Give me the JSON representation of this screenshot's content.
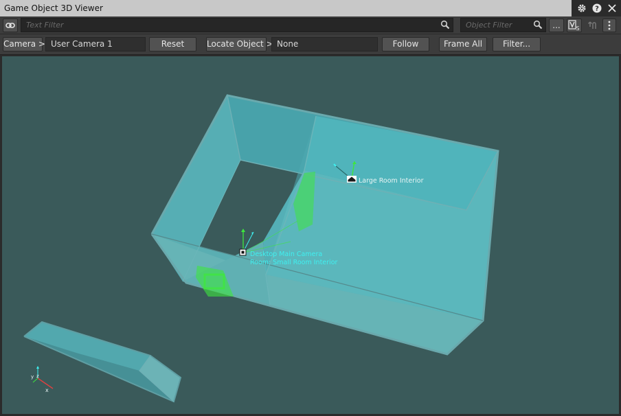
{
  "window": {
    "title": "Game Object 3D Viewer",
    "icons": [
      "gear-icon",
      "help-icon",
      "close-icon"
    ]
  },
  "toolbar": {
    "text_filter_placeholder": "Text Filter",
    "object_filter_placeholder": "Object Filter",
    "more_label": "...",
    "icons": [
      "link-icon",
      "search-icon",
      "filter-vs-icon",
      "undo-icon",
      "kebab-menu-icon"
    ]
  },
  "camera_bar": {
    "camera_label": "Camera >",
    "camera_value": "User Camera 1",
    "reset_label": "Reset",
    "locate_label": "Locate Object >",
    "locate_value": "None",
    "follow_label": "Follow",
    "frame_all_label": "Frame All",
    "filter_label": "Filter..."
  },
  "scene": {
    "objects": [
      {
        "label": "Large Room Interior",
        "icon": "home-icon"
      },
      {
        "label": "Desktop Main Camera",
        "sublabel": "Room: Small Room Interior",
        "icon": "camera-marker-icon"
      }
    ],
    "axis_gizmo": {
      "y": "y",
      "z": "z",
      "x": "x"
    },
    "colors": {
      "background": "#3a5a5a",
      "room_fill": "#4fb8bf",
      "room_edge": "#62a7ad",
      "selection_green": "#3ee63e",
      "camera_label": "#3ff0f0",
      "object_label": "#e8f4f4"
    }
  }
}
